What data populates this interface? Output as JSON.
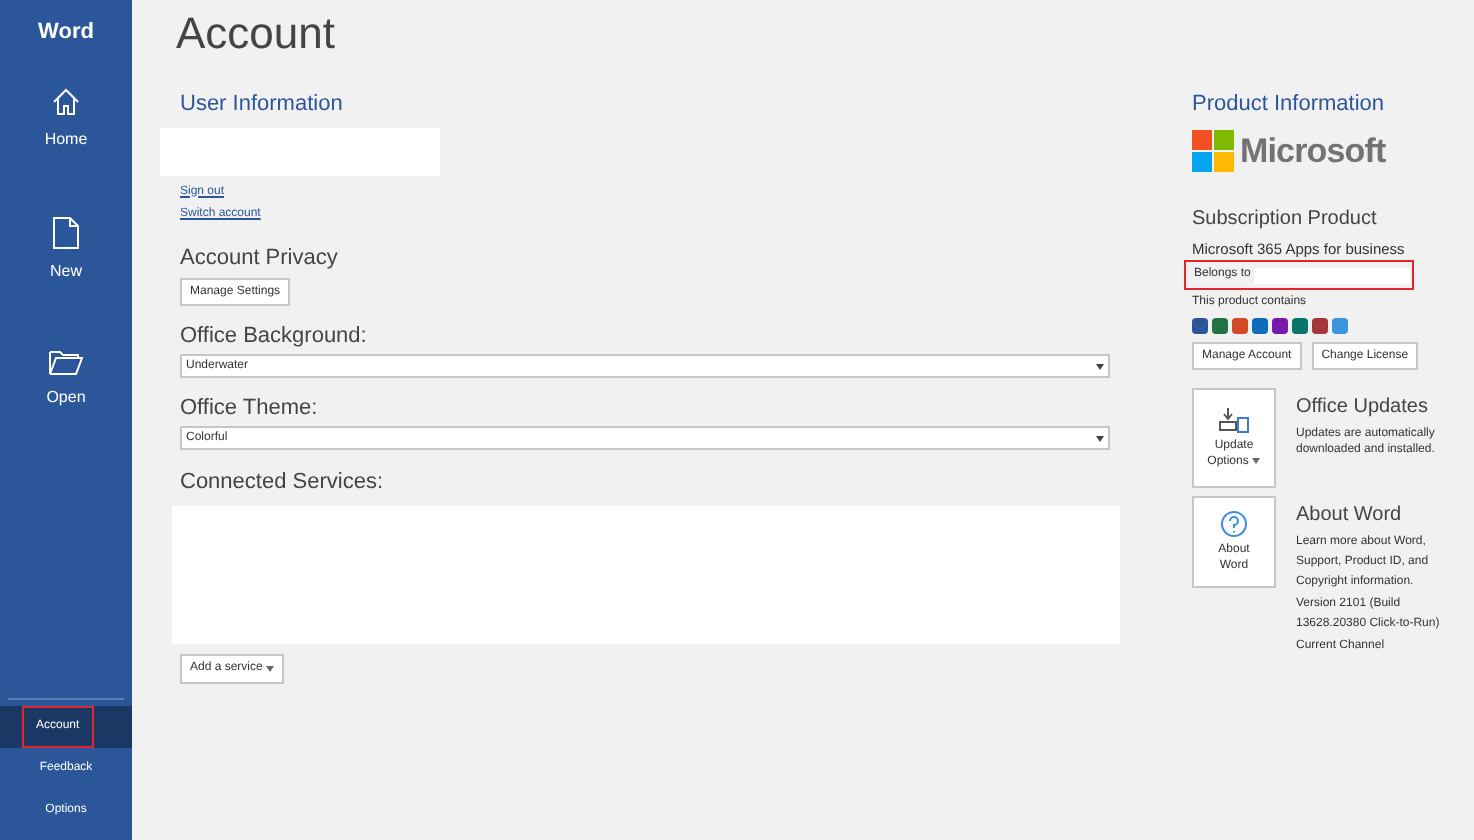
{
  "app_name": "Word",
  "nav": [
    {
      "label": "Home",
      "kind": "home",
      "selected": false,
      "highlighted": false
    },
    {
      "label": "New",
      "kind": "new",
      "selected": false,
      "highlighted": false
    },
    {
      "label": "Open",
      "kind": "open",
      "selected": false,
      "highlighted": false
    }
  ],
  "nav_bottom": [
    {
      "label": "Account",
      "selected": true,
      "highlighted": true
    },
    {
      "label": "Feedback",
      "selected": false,
      "highlighted": false
    },
    {
      "label": "Options",
      "selected": false,
      "highlighted": false
    }
  ],
  "page_title": "Account",
  "user_information": {
    "title": "User Information",
    "links": [
      "Sign out",
      "Switch account"
    ]
  },
  "account_privacy": {
    "title": "Account Privacy",
    "button": "Manage Settings"
  },
  "office_background": {
    "label": "Office Background:",
    "value": "Underwater"
  },
  "office_theme": {
    "label": "Office Theme:",
    "value": "Colorful"
  },
  "connected_services": {
    "title": "Connected Services:",
    "button": "Add a service"
  },
  "product_information": {
    "title": "Product Information",
    "logo_text": "Microsoft",
    "subscription_title": "Subscription Product",
    "product_name": "Microsoft 365 Apps for business",
    "belongs_to": "Belongs to",
    "belongs_to_highlighted": true,
    "contains_label": "This product contains",
    "apps": [
      {
        "color": "#2b579a"
      },
      {
        "color": "#217346"
      },
      {
        "color": "#d24726"
      },
      {
        "color": "#0f6cbd"
      },
      {
        "color": "#7719aa"
      },
      {
        "color": "#077568"
      },
      {
        "color": "#a4373a"
      },
      {
        "color": "#3a96dd"
      }
    ],
    "buttons": [
      "Manage Account",
      "Change License"
    ]
  },
  "office_updates": {
    "tile": "Update Options",
    "title": "Office Updates",
    "description": "Updates are automatically downloaded and installed."
  },
  "about": {
    "tile": "About Word",
    "title": "About Word",
    "description": "Learn more about Word, Support, Product ID, and Copyright information.",
    "version": "Version 2101 (Build 13628.20380 Click-to-Run)",
    "channel": "Current Channel"
  }
}
